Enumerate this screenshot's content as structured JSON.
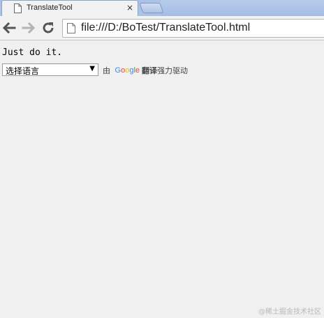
{
  "tab": {
    "title": "TranslateTool",
    "close": "×"
  },
  "toolbar": {
    "url": "file:///D:/BoTest/TranslateTool.html"
  },
  "page": {
    "text": "Just do it.",
    "select": {
      "value": "选择语言",
      "arrow": "▼"
    },
    "powered_by": {
      "prefix": "由",
      "logo": [
        "G",
        "o",
        "o",
        "g",
        "l",
        "e"
      ],
      "bold": "翻译",
      "suffix": "强力驱动"
    }
  },
  "watermark": "@稀土掘金技术社区",
  "icons": {
    "favicon": "page-icon",
    "back": "arrow-left-icon",
    "forward": "arrow-right-icon",
    "reload": "reload-icon"
  },
  "colors": {
    "tab_strip": "#a9c2e6",
    "google_blue": "#4285f4",
    "google_red": "#ea4335",
    "google_yellow": "#fbbc05",
    "google_green": "#34a853"
  }
}
